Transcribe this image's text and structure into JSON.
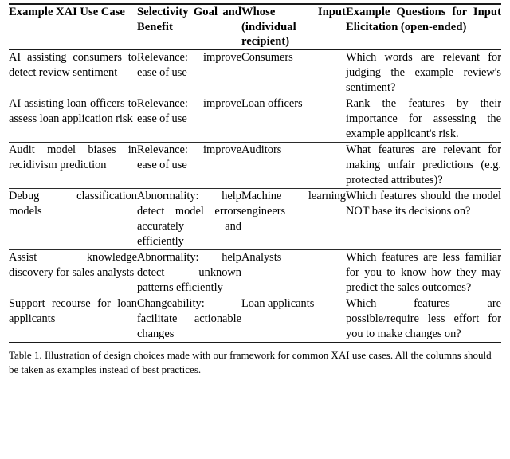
{
  "table": {
    "columns": [
      "Example XAI Use Case",
      "Selectivity Goal and Benefit",
      "Whose Input (individual recipient)",
      "Example Questions for Input Elicitation (open-ended)"
    ],
    "rows": [
      {
        "use_case": "AI assisting consumers to detect review sentiment",
        "selectivity_goal": "Relevance: improve ease of use",
        "whose_input": "Consumers",
        "example_question": "Which words are relevant for judging the example review's sentiment?"
      },
      {
        "use_case": "AI assisting loan officers to assess loan application risk",
        "selectivity_goal": "Relevance: improve ease of use",
        "whose_input": "Loan officers",
        "example_question": "Rank the features by their importance for assessing the example applicant's risk."
      },
      {
        "use_case": "Audit model biases in recidivism prediction",
        "selectivity_goal": "Relevance: improve ease of use",
        "whose_input": "Auditors",
        "example_question": "What features are relevant for making unfair predictions (e.g. protected attributes)?"
      },
      {
        "use_case": "Debug classification models",
        "selectivity_goal": "Abnormality: help detect model errors accurately and efficiently",
        "whose_input": "Machine learning engineers",
        "example_question": "Which features should the model NOT base its decisions on?"
      },
      {
        "use_case": "Assist knowledge discovery for sales analysts",
        "selectivity_goal": "Abnormality: help detect unknown patterns efficiently",
        "whose_input": "Analysts",
        "example_question": "Which features are less familiar for you to know how they may predict the sales outcomes?"
      },
      {
        "use_case": "Support recourse for loan applicants",
        "selectivity_goal": "Changeability: facilitate actionable changes",
        "whose_input": "Loan applicants",
        "example_question": "Which features are possible/require less effort for you to make changes on?"
      }
    ]
  },
  "caption": {
    "label": "Table 1.",
    "text": "Illustration of design choices made with our framework for common XAI use cases. All the columns should be taken as examples instead of best practices."
  },
  "colors": {
    "text": "#000000",
    "rule": "#1a1a1a",
    "background": "#ffffff"
  }
}
